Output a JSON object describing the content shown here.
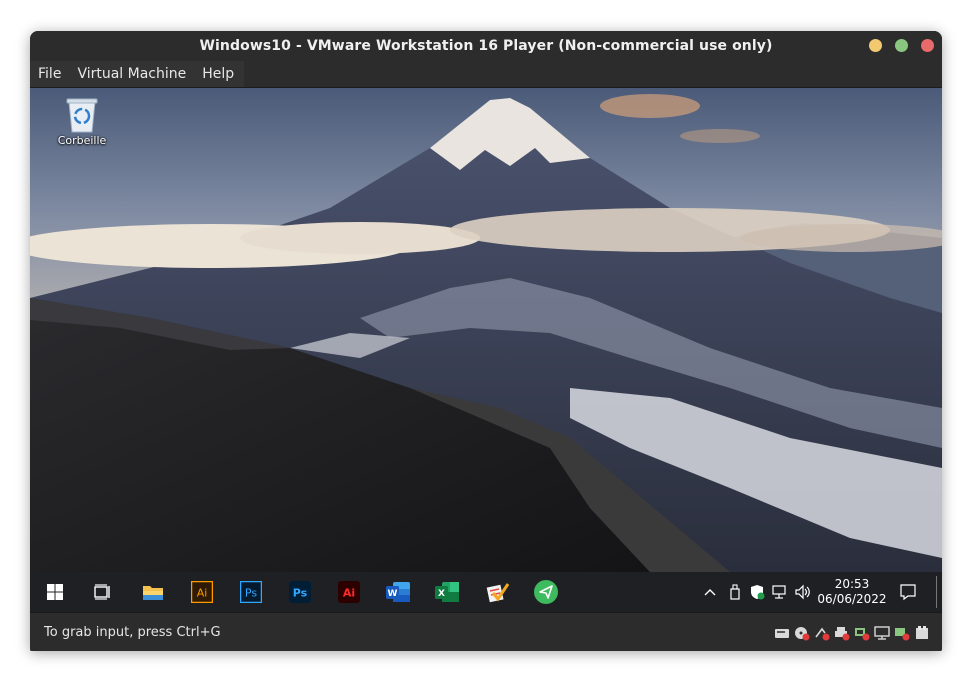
{
  "window": {
    "title": "Windows10  - VMware Workstation 16 Player (Non-commercial use only)"
  },
  "menu": {
    "items": [
      "File",
      "Virtual Machine",
      "Help"
    ]
  },
  "desktop": {
    "icons": [
      {
        "label": "Corbeille",
        "icon": "recycle-bin-icon"
      }
    ]
  },
  "taskbar": {
    "apps": [
      {
        "name": "start",
        "icon": "windows-logo-icon"
      },
      {
        "name": "task-view",
        "icon": "task-view-icon"
      },
      {
        "name": "file-explorer",
        "icon": "folder-icon"
      },
      {
        "name": "illustrator",
        "icon": "illustrator-icon",
        "text": "Ai"
      },
      {
        "name": "photoshop",
        "icon": "photoshop-icon",
        "text": "Ps"
      },
      {
        "name": "photoshop-2",
        "icon": "photoshop-icon",
        "text": "Ps"
      },
      {
        "name": "acrobat",
        "icon": "acrobat-icon",
        "text": "Ai"
      },
      {
        "name": "word",
        "icon": "word-icon",
        "text": "W"
      },
      {
        "name": "excel",
        "icon": "excel-icon",
        "text": "X"
      },
      {
        "name": "tasks",
        "icon": "checklist-icon"
      },
      {
        "name": "send",
        "icon": "paper-plane-icon"
      }
    ],
    "tray": {
      "time": "20:53",
      "date": "06/06/2022"
    },
    "colors": {
      "illustrator": "#ff9a00",
      "photoshop": "#31a8ff",
      "acrobat": "#ff0000",
      "word": "#2b579a",
      "excel": "#217346"
    }
  },
  "status": {
    "text": "To grab input, press Ctrl+G"
  }
}
